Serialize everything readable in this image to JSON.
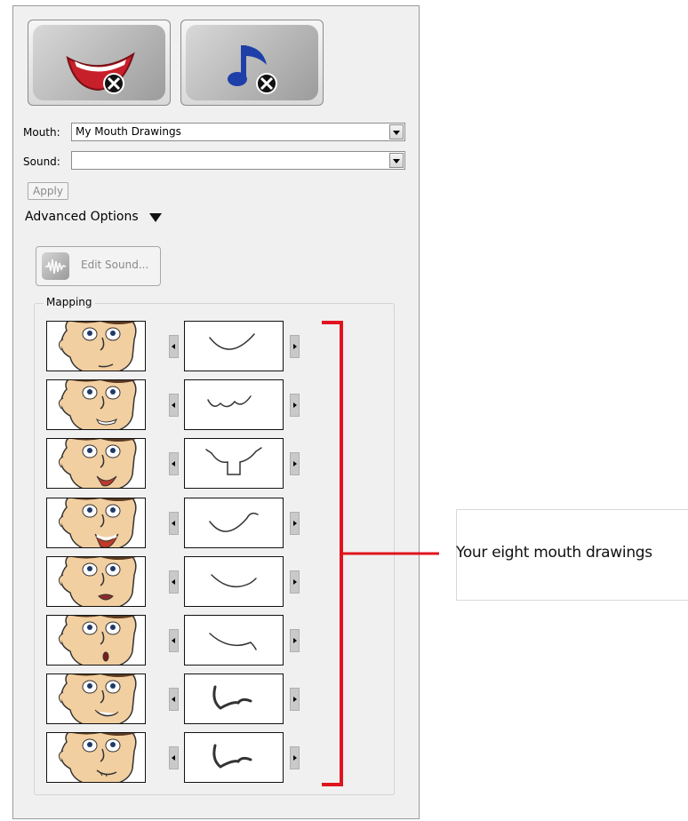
{
  "buttons": {
    "add_mouth_icon": "mouth-add-icon",
    "add_sound_icon": "sound-add-icon"
  },
  "mouth": {
    "label": "Mouth:",
    "value": "My Mouth Drawings"
  },
  "sound": {
    "label": "Sound:",
    "value": ""
  },
  "apply_label": "Apply",
  "advanced_label": "Advanced Options",
  "edit_sound_label": "Edit Sound...",
  "mapping": {
    "title": "Mapping",
    "rows": [
      {
        "face": "face-mouth-1",
        "mouth": "mouth-drawing-1"
      },
      {
        "face": "face-mouth-2",
        "mouth": "mouth-drawing-2"
      },
      {
        "face": "face-mouth-3",
        "mouth": "mouth-drawing-3"
      },
      {
        "face": "face-mouth-4",
        "mouth": "mouth-drawing-4"
      },
      {
        "face": "face-mouth-5",
        "mouth": "mouth-drawing-5"
      },
      {
        "face": "face-mouth-6",
        "mouth": "mouth-drawing-6"
      },
      {
        "face": "face-mouth-7",
        "mouth": "mouth-drawing-7"
      },
      {
        "face": "face-mouth-8",
        "mouth": "mouth-drawing-8"
      }
    ]
  },
  "callout": {
    "text": "Your eight mouth drawings",
    "bracket_color": "#e0141e"
  }
}
